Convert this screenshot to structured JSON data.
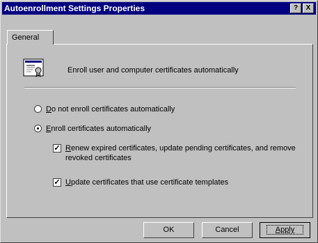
{
  "window": {
    "title": "Autoenrollment Settings Properties",
    "help_btn": "?",
    "close_btn": "X"
  },
  "tabs": [
    {
      "label": "General",
      "selected": true
    }
  ],
  "header": {
    "text": "Enroll user and computer certificates automatically",
    "icon": "certificate-icon"
  },
  "options": {
    "do_not_enroll": {
      "mnemonic": "D",
      "rest": "o not enroll certificates automatically",
      "selected": false
    },
    "enroll": {
      "mnemonic": "E",
      "rest": "nroll certificates automatically",
      "selected": true
    },
    "renew": {
      "mnemonic": "R",
      "rest": "enew expired certificates, update pending certificates, and remove",
      "line2": "revoked certificates",
      "checked": true
    },
    "update": {
      "mnemonic": "U",
      "rest": "pdate certificates that use certificate templates",
      "checked": true
    }
  },
  "buttons": {
    "ok": "OK",
    "cancel": "Cancel",
    "apply": "Apply"
  }
}
